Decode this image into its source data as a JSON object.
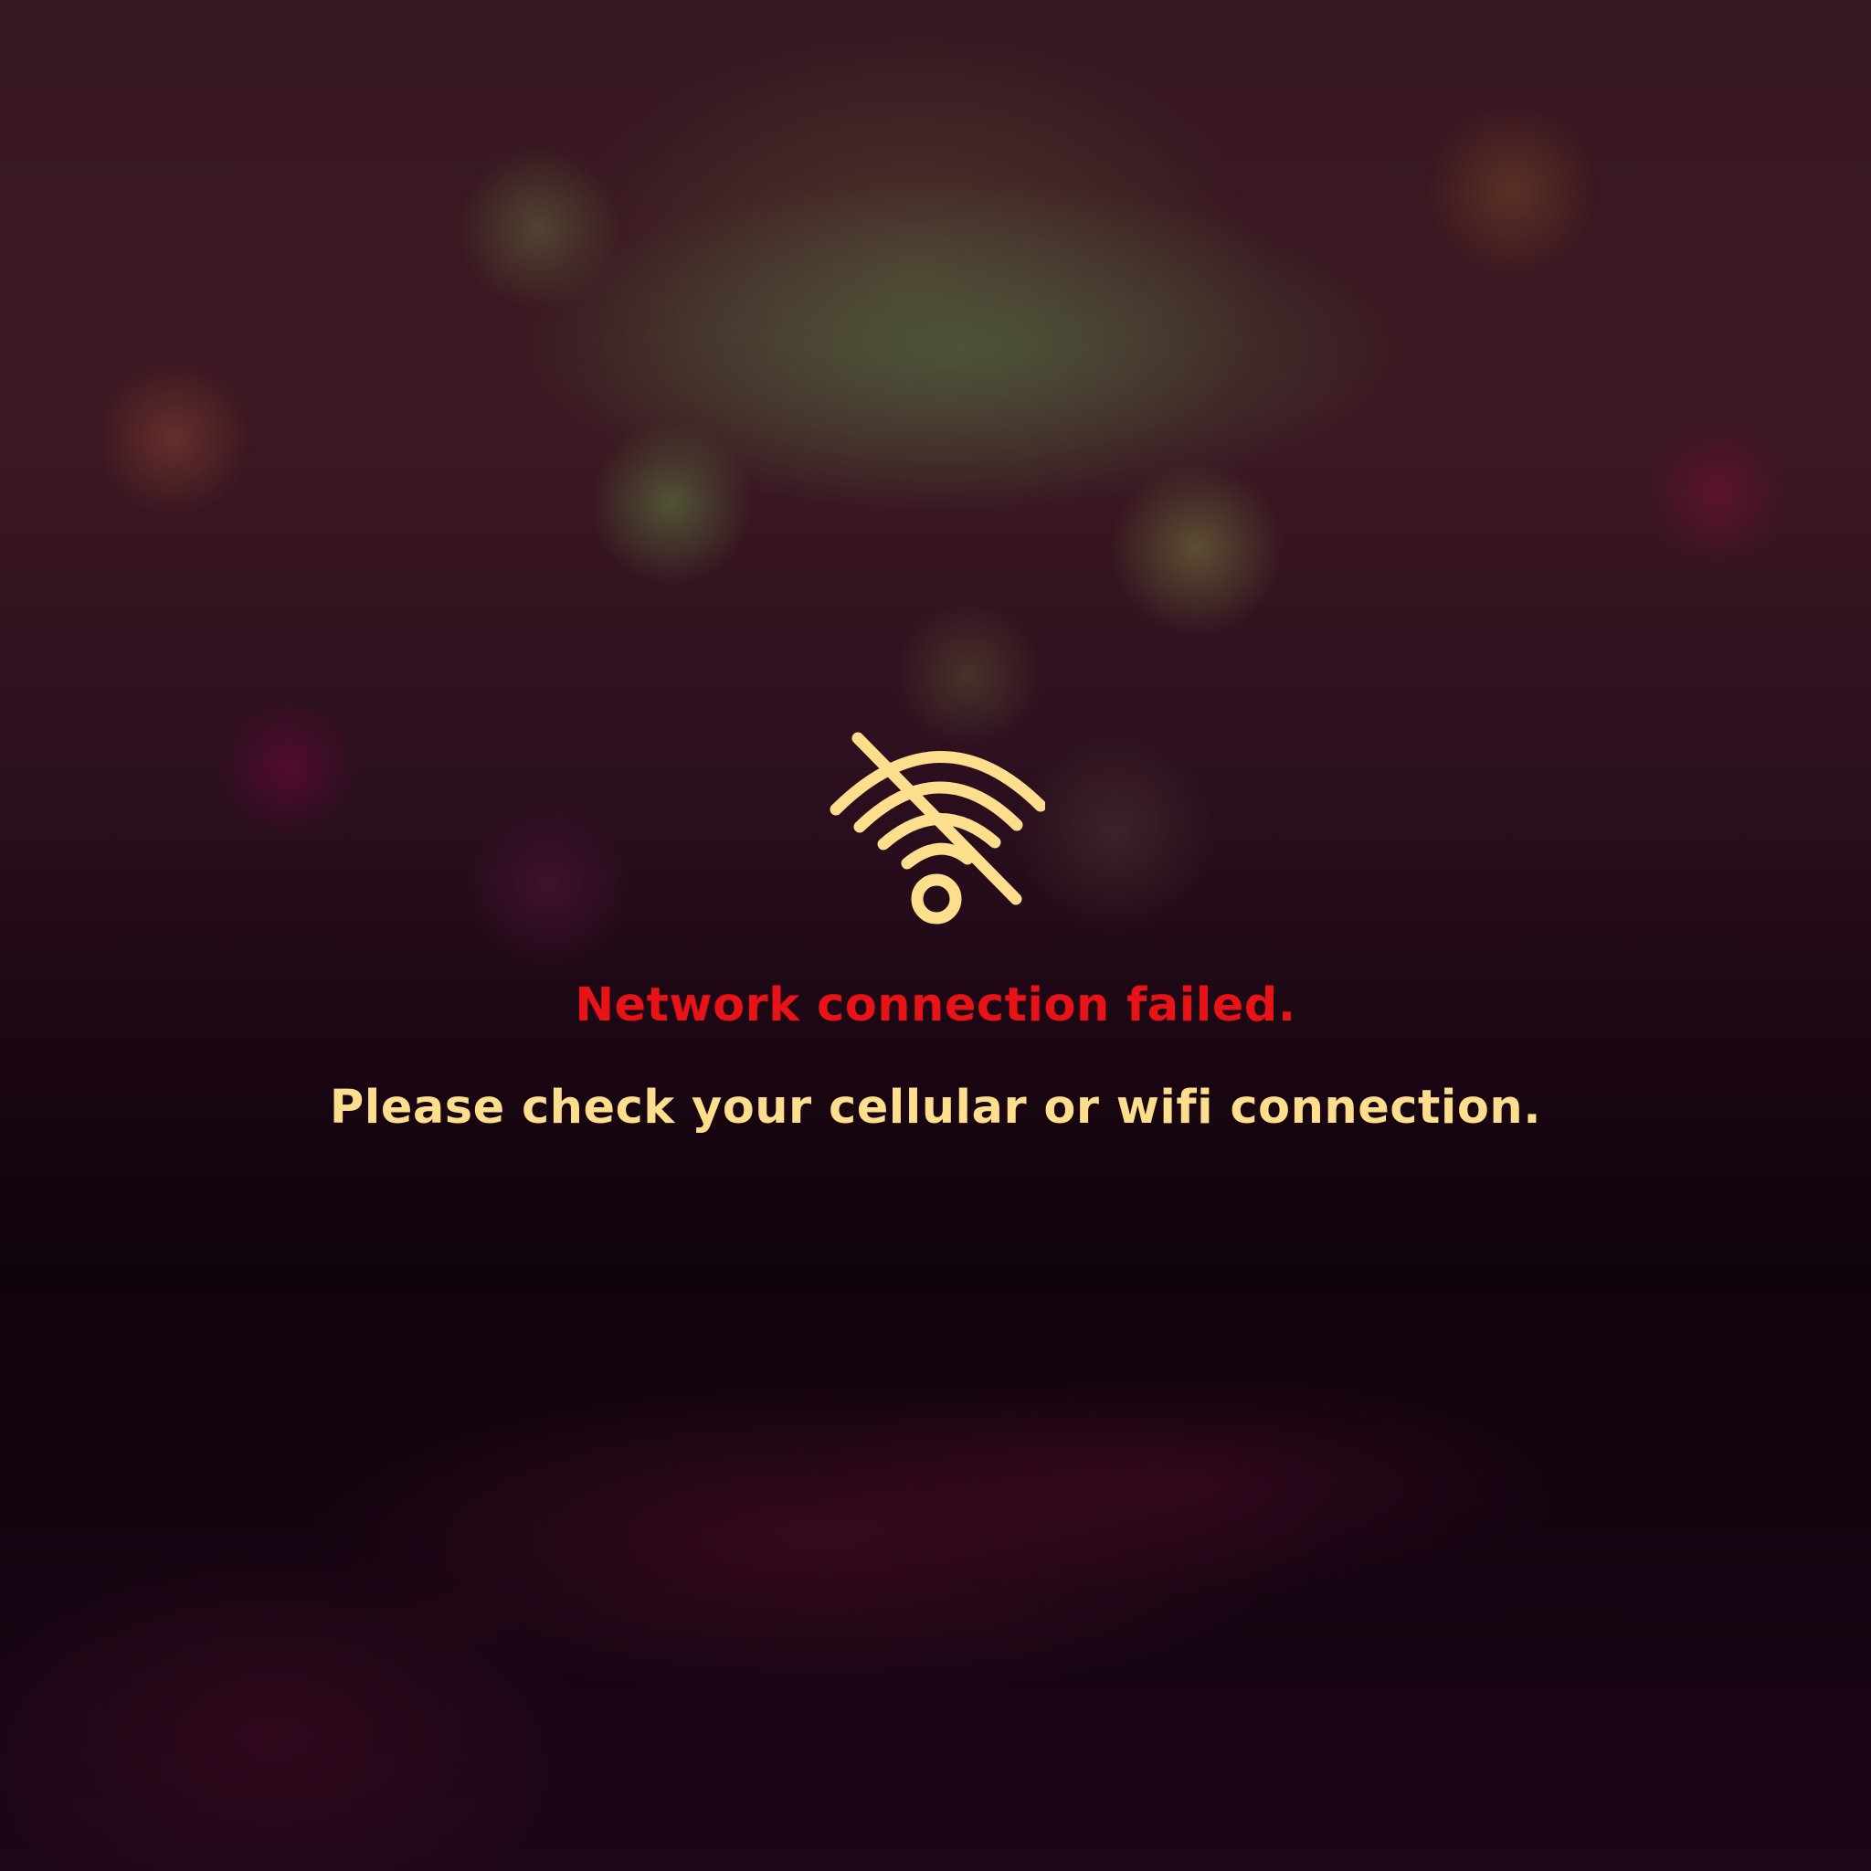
{
  "error_screen": {
    "icon": "wifi-off-icon",
    "title": "Network connection failed.",
    "message": "Please check your cellular or wifi connection."
  },
  "colors": {
    "title": "#e81317",
    "message": "#fdde8c",
    "icon": "#fdde8c"
  }
}
